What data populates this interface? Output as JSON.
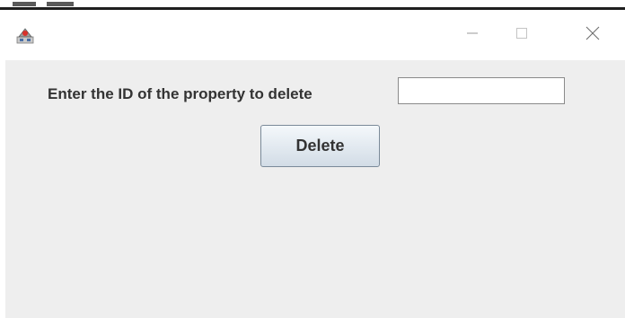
{
  "window": {
    "icon": "java-app-icon",
    "controls": {
      "minimize_icon": "minimize-icon",
      "maximize_icon": "maximize-icon",
      "close_icon": "close-icon"
    }
  },
  "form": {
    "prompt_label": "Enter the ID of the property to delete",
    "id_value": "",
    "delete_label": "Delete"
  },
  "colors": {
    "content_background": "#eeeeee",
    "titlebar_background": "#ffffff",
    "label_text": "#333333"
  }
}
